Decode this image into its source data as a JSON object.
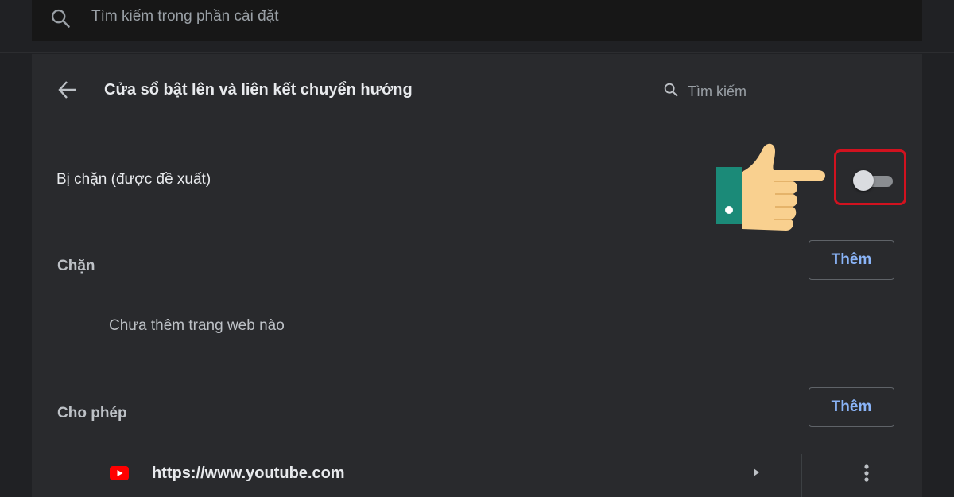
{
  "top_search": {
    "placeholder": "Tìm kiếm trong phần cài đặt",
    "icon": "search-icon"
  },
  "header": {
    "title": "Cửa sổ bật lên và liên kết chuyển hướng",
    "back_icon": "arrow-back-icon",
    "search_placeholder": "Tìm kiếm",
    "search_icon": "search-icon"
  },
  "setting": {
    "label": "Bị chặn (được đề xuất)",
    "toggle_on": false,
    "highlight_color": "#d1121f"
  },
  "blocked_section": {
    "title": "Chặn",
    "add_label": "Thêm",
    "empty_message": "Chưa thêm trang web nào"
  },
  "allowed_section": {
    "title": "Cho phép",
    "add_label": "Thêm",
    "sites": [
      {
        "url": "https://www.youtube.com",
        "icon": "youtube-icon"
      }
    ]
  },
  "colors": {
    "background": "#202124",
    "card": "#292a2d",
    "accent": "#8ab4f8"
  }
}
